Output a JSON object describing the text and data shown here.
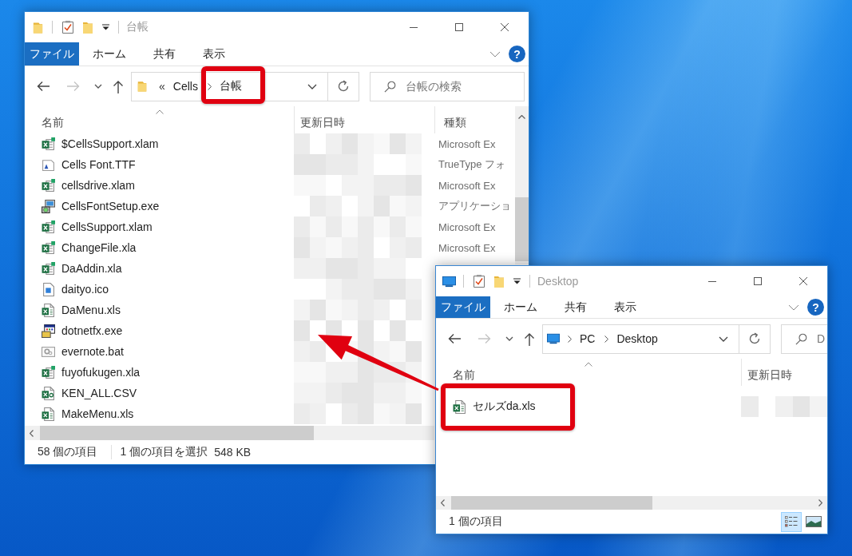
{
  "windows": [
    {
      "kind": "folder",
      "title": "台帳",
      "ribbon": {
        "file_tab": "ファイル",
        "tabs": [
          "ホーム",
          "共有",
          "表示"
        ],
        "help": "?"
      },
      "address": {
        "overflow_mark": "«",
        "crumbs": [
          {
            "label": "Cells",
            "highlighted": false
          },
          {
            "label": "台帳",
            "highlighted": true
          }
        ]
      },
      "search": {
        "placeholder": "台帳の検索"
      },
      "columns": [
        {
          "label": "名前",
          "sorted": true
        },
        {
          "label": "更新日時",
          "sorted": false
        },
        {
          "label": "種類",
          "sorted": false
        }
      ],
      "dates_pixelated": true,
      "files": [
        {
          "name": "$CellsSupport.xlam",
          "kind": "addin",
          "type": "Microsoft Ex",
          "highlighted": false
        },
        {
          "name": "Cells Font.TTF",
          "kind": "font",
          "type": "TrueType フォ",
          "highlighted": false
        },
        {
          "name": "cellsdrive.xlam",
          "kind": "addin",
          "type": "Microsoft Ex",
          "highlighted": false
        },
        {
          "name": "CellsFontSetup.exe",
          "kind": "installer",
          "type": "アプリケーショ",
          "highlighted": false
        },
        {
          "name": "CellsSupport.xlam",
          "kind": "addin",
          "type": "Microsoft Ex",
          "highlighted": false
        },
        {
          "name": "ChangeFile.xla",
          "kind": "addin",
          "type": "Microsoft Ex",
          "highlighted": false
        },
        {
          "name": "DaAddin.xla",
          "kind": "addin",
          "highlighted": false
        },
        {
          "name": "daityo.ico",
          "kind": "image",
          "highlighted": false
        },
        {
          "name": "DaMenu.xls",
          "kind": "sheet",
          "highlighted": false
        },
        {
          "name": "dotnetfx.exe",
          "kind": "app",
          "highlighted": false
        },
        {
          "name": "evernote.bat",
          "kind": "script",
          "highlighted": false
        },
        {
          "name": "fuyofukugen.xla",
          "kind": "addin",
          "highlighted": false
        },
        {
          "name": "KEN_ALL.CSV",
          "kind": "csv",
          "highlighted": false
        },
        {
          "name": "MakeMenu.xls",
          "kind": "sheet",
          "highlighted": false
        }
      ],
      "status": [
        "58 個の項目",
        "1 個の項目を選択",
        "548 KB"
      ]
    },
    {
      "kind": "pc",
      "title": "Desktop",
      "ribbon": {
        "file_tab": "ファイル",
        "tabs": [
          "ホーム",
          "共有",
          "表示"
        ],
        "help": "?"
      },
      "address": {
        "crumbs": [
          {
            "label": "PC",
            "highlighted": false
          },
          {
            "label": "Desktop",
            "highlighted": false
          }
        ]
      },
      "search": {
        "placeholder": "D"
      },
      "columns": [
        {
          "label": "名前",
          "sorted": true
        },
        {
          "label": "更新日時",
          "sorted": false
        }
      ],
      "dates_pixelated": true,
      "files": [
        {
          "name": "セルズda.xls",
          "kind": "sheet",
          "highlighted": true
        }
      ],
      "status": [
        "1 個の項目"
      ],
      "views": [
        {
          "kind": "details",
          "selected": true
        },
        {
          "kind": "large_icons",
          "selected": false
        }
      ]
    }
  ],
  "arrow": true
}
